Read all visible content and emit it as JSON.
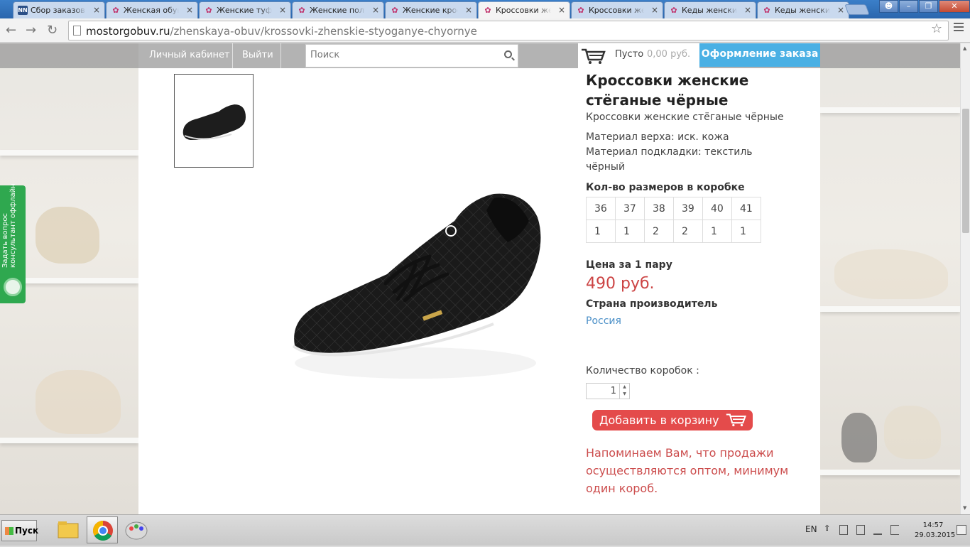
{
  "browser": {
    "tabs": [
      {
        "title": "Сбор заказов!Р",
        "icon": "nn-favicon",
        "active": false
      },
      {
        "title": "Женская обувь",
        "icon": "site-favicon",
        "active": false
      },
      {
        "title": "Женские туфли",
        "icon": "site-favicon",
        "active": false
      },
      {
        "title": "Женские полуб",
        "icon": "site-favicon",
        "active": false
      },
      {
        "title": "Женские кросс",
        "icon": "site-favicon",
        "active": false
      },
      {
        "title": "Кроссовки жен",
        "icon": "site-favicon",
        "active": true
      },
      {
        "title": "Кроссовки жен",
        "icon": "site-favicon",
        "active": false
      },
      {
        "title": "Кеды женские",
        "icon": "site-favicon",
        "active": false
      },
      {
        "title": "Кеды женские",
        "icon": "site-favicon",
        "active": false
      }
    ],
    "url_host": "mostorgobuv.ru",
    "url_path": "/zhenskaya-obuv/krossovki-zhenskie-styoganye-chyornye"
  },
  "site_header": {
    "account_link": "Личный кабинет",
    "logout_link": "Выйти",
    "search_placeholder": "Поиск",
    "cart_status": "Пусто",
    "cart_sum": "0,00 руб.",
    "checkout": "Оформление заказа"
  },
  "product": {
    "title": "Кроссовки женские стёганые чёрные",
    "subtitle": "Кроссовки женские стёганые чёрные",
    "specs": [
      "Материал верха: иск. кожа",
      "Материал подкладки: текстиль",
      "чёрный"
    ],
    "sizes_header": "Кол-во размеров в коробке",
    "sizes": [
      "36",
      "37",
      "38",
      "39",
      "40",
      "41"
    ],
    "counts": [
      "1",
      "1",
      "2",
      "2",
      "1",
      "1"
    ],
    "price_label": "Цена за 1 пару",
    "price": "490 руб.",
    "country_label": "Страна производитель",
    "country": "Россия",
    "qty_label": "Количество коробок :",
    "qty_value": "1",
    "add_to_cart": "Добавить в корзину",
    "notice": "Напоминаем Вам, что продажи осуществляются оптом, минимум один короб."
  },
  "side_widget": {
    "line1": "Задать вопрос",
    "line2": "консультант оффлайн"
  },
  "taskbar": {
    "start": "Пуск",
    "lang": "EN",
    "time": "14:57",
    "date": "29.03.2015"
  },
  "colors": {
    "accent_blue": "#4ab0e4",
    "price_red": "#cc4444",
    "button_red": "#e44b4b",
    "link_blue": "#4a8fc7",
    "widget_green": "#2fa84f"
  }
}
